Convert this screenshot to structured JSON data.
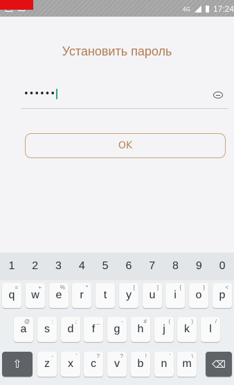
{
  "status_bar": {
    "network_label": "4G",
    "time": "17:24"
  },
  "screen": {
    "title": "Установить пароль",
    "password_value": "••••••",
    "ok_label": "OK"
  },
  "keyboard": {
    "number_row": [
      "1",
      "2",
      "3",
      "4",
      "5",
      "6",
      "7",
      "8",
      "9",
      "0"
    ],
    "row1": [
      {
        "key": "q",
        "hint": "="
      },
      {
        "key": "w",
        "hint": "+"
      },
      {
        "key": "e",
        "hint": "%"
      },
      {
        "key": "r",
        "hint": "*"
      },
      {
        "key": "t",
        "hint": ""
      },
      {
        "key": "y",
        "hint": "["
      },
      {
        "key": "u",
        "hint": "]"
      },
      {
        "key": "i",
        "hint": "{"
      },
      {
        "key": "o",
        "hint": "}"
      },
      {
        "key": "p",
        "hint": "<"
      }
    ],
    "row2": [
      {
        "key": "a",
        "hint": "@"
      },
      {
        "key": "s",
        "hint": ":"
      },
      {
        "key": "d",
        "hint": ";"
      },
      {
        "key": "f",
        "hint": "_"
      },
      {
        "key": "g",
        "hint": "-"
      },
      {
        "key": "h",
        "hint": "#"
      },
      {
        "key": "j",
        "hint": "("
      },
      {
        "key": "k",
        "hint": ")"
      },
      {
        "key": "l",
        "hint": "/"
      }
    ],
    "row3": [
      {
        "key": "z",
        "hint": "-"
      },
      {
        "key": "x",
        "hint": "'"
      },
      {
        "key": "c",
        "hint": "?"
      },
      {
        "key": "v",
        "hint": "?"
      },
      {
        "key": "b",
        "hint": "!"
      },
      {
        "key": "n",
        "hint": "'"
      },
      {
        "key": "m",
        "hint": "\\"
      }
    ],
    "shift_glyph": "⇧",
    "backspace_glyph": "⌫"
  }
}
